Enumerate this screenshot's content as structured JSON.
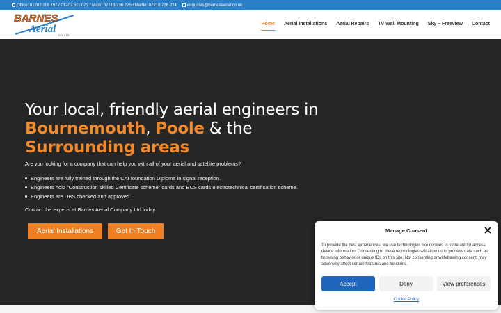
{
  "topbar": {
    "phones": "Office: 01202 118 797 / 01202 511 072 / Mark: 07718 736 225 / Martin: 07718 736 224",
    "email": "enquiries@barnesaerial.co.uk"
  },
  "logo": {
    "line1": "BARNES",
    "line2": "Aerial",
    "line3": "CO. LTD"
  },
  "nav": {
    "items": [
      "Home",
      "Aerial Installations",
      "Aerial Repairs",
      "TV Wall Mounting",
      "Sky – Freeview",
      "Contact"
    ],
    "active_index": 0
  },
  "hero": {
    "heading_part1": "Your local, friendly aerial engineers in",
    "heading_bournemouth": "Bournemouth",
    "heading_comma": ", ",
    "heading_poole": "Poole",
    "heading_the": " & the",
    "heading_surrounding": "Surrounding areas",
    "intro": "Are you looking for a company that can help you with all of your aerial and satellite problems?",
    "bullets": [
      "Engineers are fully trained through the CAI foundation Diploma in signal reception.",
      "Engineers hold “Construction skilled Certificate scheme” cards and ECS cards electrotechnical certification scheme.",
      "Engineers are DBS checked and approved."
    ],
    "contact_line": "Contact the experts at Barnes Aerial Company Ltd today.",
    "button_installations": "Aerial Installations",
    "button_touch": "Get In Touch"
  },
  "consent": {
    "title": "Manage Consent",
    "text": "To provide the best experiences, we use technologies like cookies to store and/or access device information. Consenting to these technologies will allow us to process data such as browsing behavior or unique IDs on this site. Not consenting or withdrawing consent, may adversely affect certain features and functions.",
    "accept": "Accept",
    "deny": "Deny",
    "preferences": "View preferences",
    "policy": "Cookie Policy"
  },
  "colors": {
    "accent": "#f07f23",
    "topbar": "#2b7fc6",
    "hero_bg": "#262626",
    "consent_accept": "#2166bd"
  }
}
